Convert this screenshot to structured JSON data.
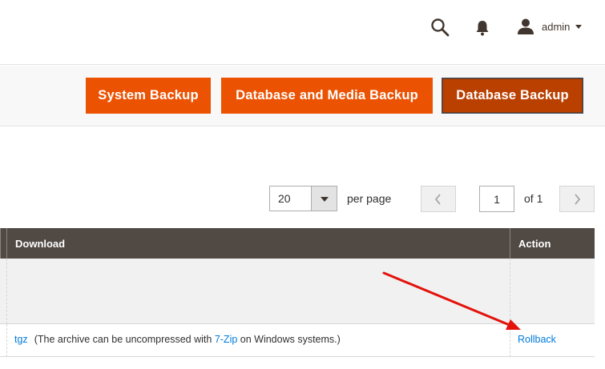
{
  "header": {
    "user_name": "admin"
  },
  "actions": {
    "system_backup": "System Backup",
    "db_media_backup": "Database and Media Backup",
    "db_backup": "Database Backup"
  },
  "pager": {
    "per_page_value": "20",
    "per_page_label": "per page",
    "current_page": "1",
    "of_pages": "of 1"
  },
  "grid": {
    "columns": {
      "download": "Download",
      "action": "Action"
    },
    "rows": [
      {
        "download_type": "tgz",
        "note_before": "(The archive can be uncompressed with ",
        "note_link": "7-Zip",
        "note_after": " on Windows systems.)",
        "action": "Rollback"
      }
    ]
  },
  "colors": {
    "accent": "#eb5202",
    "accent_active": "#ba4000",
    "grid_header": "#514943",
    "link": "#007bdb",
    "annotation": "#e3120b"
  }
}
